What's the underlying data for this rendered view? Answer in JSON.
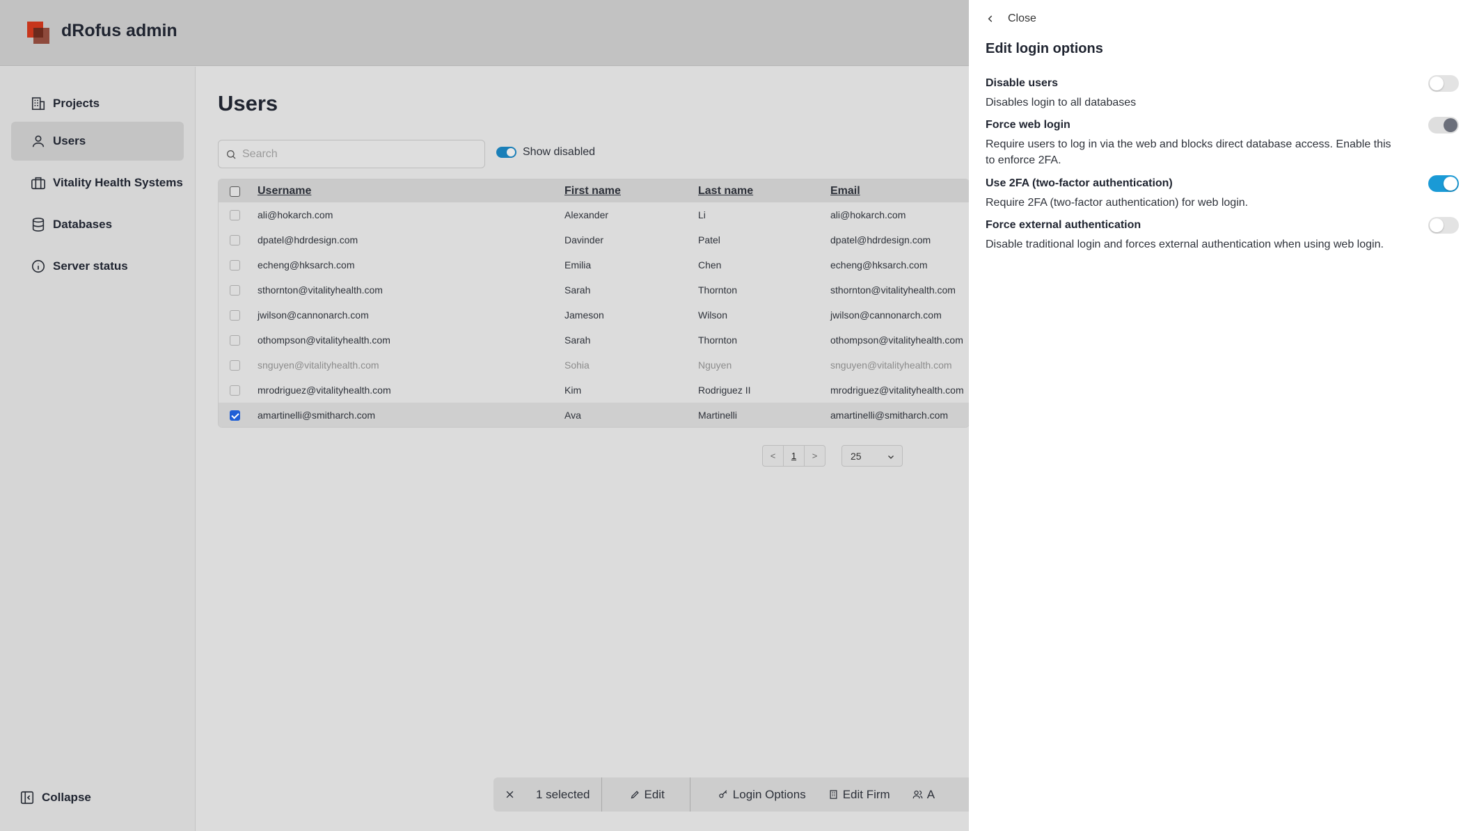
{
  "app": {
    "title": "dRofus admin"
  },
  "sidebar": {
    "items": [
      {
        "label": "Projects",
        "icon": "building-icon"
      },
      {
        "label": "Users",
        "icon": "user-icon"
      },
      {
        "label": "Vitality Health Systems",
        "icon": "briefcase-icon"
      },
      {
        "label": "Databases",
        "icon": "database-icon"
      },
      {
        "label": "Server status",
        "icon": "info-icon"
      }
    ],
    "active": "Users",
    "collapse_label": "Collapse"
  },
  "main": {
    "title": "Users",
    "search": {
      "placeholder": "Search",
      "value": ""
    },
    "show_disabled": {
      "label": "Show disabled",
      "on": true
    },
    "table": {
      "columns": [
        "Username",
        "First name",
        "Last name",
        "Email"
      ],
      "rows": [
        {
          "username": "ali@hokarch.com",
          "first": "Alexander",
          "last": "Li",
          "email": "ali@hokarch.com",
          "disabled": false,
          "selected": false
        },
        {
          "username": "dpatel@hdrdesign.com",
          "first": "Davinder",
          "last": "Patel",
          "email": "dpatel@hdrdesign.com",
          "disabled": false,
          "selected": false
        },
        {
          "username": "echeng@hksarch.com",
          "first": "Emilia",
          "last": "Chen",
          "email": "echeng@hksarch.com",
          "disabled": false,
          "selected": false
        },
        {
          "username": "sthornton@vitalityhealth.com",
          "first": "Sarah",
          "last": "Thornton",
          "email": "sthornton@vitalityhealth.com",
          "disabled": false,
          "selected": false
        },
        {
          "username": "jwilson@cannonarch.com",
          "first": "Jameson",
          "last": "Wilson",
          "email": "jwilson@cannonarch.com",
          "disabled": false,
          "selected": false
        },
        {
          "username": "othompson@vitalityhealth.com",
          "first": "Sarah",
          "last": "Thornton",
          "email": "othompson@vitalityhealth.com",
          "disabled": false,
          "selected": false
        },
        {
          "username": "snguyen@vitalityhealth.com",
          "first": "Sohia",
          "last": "Nguyen",
          "email": "snguyen@vitalityhealth.com",
          "disabled": true,
          "selected": false
        },
        {
          "username": "mrodriguez@vitalityhealth.com",
          "first": "Kim",
          "last": "Rodriguez II",
          "email": "mrodriguez@vitalityhealth.com",
          "disabled": false,
          "selected": false
        },
        {
          "username": "amartinelli@smitharch.com",
          "first": "Ava",
          "last": "Martinelli",
          "email": "amartinelli@smitharch.com",
          "disabled": false,
          "selected": true
        }
      ]
    },
    "pagination": {
      "prev": "<",
      "current": "1",
      "next": ">",
      "page_size": "25"
    },
    "action_bar": {
      "selected_label": "1 selected",
      "edit_label": "Edit",
      "login_options_label": "Login Options",
      "edit_firm_label": "Edit Firm",
      "add_label": "A"
    }
  },
  "panel": {
    "close_label": "Close",
    "title": "Edit login options",
    "options": [
      {
        "title": "Disable users",
        "description": "Disables login to all databases",
        "state": "off"
      },
      {
        "title": "Force web login",
        "description": "Require users to log in via the web and blocks direct database access. Enable this to enforce 2FA.",
        "state": "on-disabled"
      },
      {
        "title": "Use 2FA (two-factor authentication)",
        "description": "Require 2FA (two-factor authentication) for web login.",
        "state": "on"
      },
      {
        "title": "Force external authentication",
        "description": "Disable traditional login and forces external authentication when using web login.",
        "state": "off"
      }
    ]
  },
  "colors": {
    "accent": "#1a9ad6",
    "checkbox": "#1f5fd6",
    "brand": "#c7361c"
  }
}
